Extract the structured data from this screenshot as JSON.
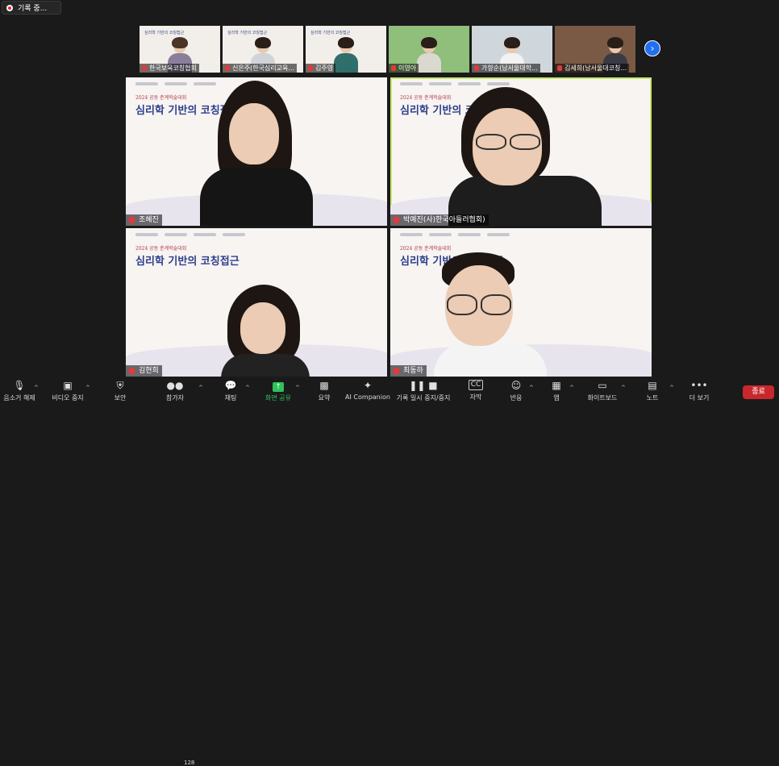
{
  "recording": {
    "label": "기록 중..."
  },
  "thumbnails": [
    {
      "name": "한국보육코칭협회",
      "slide_title": "심리학 기반의 코칭접근"
    },
    {
      "name": "신은주(한국심리교육...",
      "slide_title": "심리학 기반의 코칭접근"
    },
    {
      "name": "김주영",
      "slide_title": "심리학 기반의 코칭접근"
    },
    {
      "name": "이영아",
      "slide_title": ""
    },
    {
      "name": "가향순(남서울대학...",
      "slide_title": ""
    },
    {
      "name": "김세희(남서울대코칭...",
      "slide_title": ""
    }
  ],
  "tiles": [
    {
      "name": "조혜진",
      "conference": "2024 공동 춘계학술대회",
      "slide_title": "심리학 기반의 코칭접근"
    },
    {
      "name": "박예진(사)한국아들러협회)",
      "conference": "2024 공동 춘계학술대회",
      "slide_title": "심리학 기반의 코칭접근"
    },
    {
      "name": "김현희",
      "conference": "2024 공동 춘계학술대회",
      "slide_title": "심리학 기반의 코칭접근"
    },
    {
      "name": "최동하",
      "conference": "2024 공동 춘계학술대회",
      "slide_title": "심리학 기반의 코칭접근"
    }
  ],
  "toolbar": {
    "mute": "음소거 해제",
    "video": "비디오 중지",
    "security": "보안",
    "participants": "참가자",
    "participants_count": "128",
    "chat": "채팅",
    "share": "화면 공유",
    "summary": "요약",
    "ai": "AI Companion",
    "record": "기록 일시 중지/중지",
    "captions": "자막",
    "reactions": "반응",
    "apps": "앱",
    "whiteboard": "화이트보드",
    "notes": "노트",
    "more": "더 보기",
    "end": "종료"
  },
  "accent_colors": {
    "share_green": "#2ec25a",
    "end_red": "#c8282d",
    "active_speaker": "#c8e86a",
    "next_button": "#1f6ff0"
  }
}
